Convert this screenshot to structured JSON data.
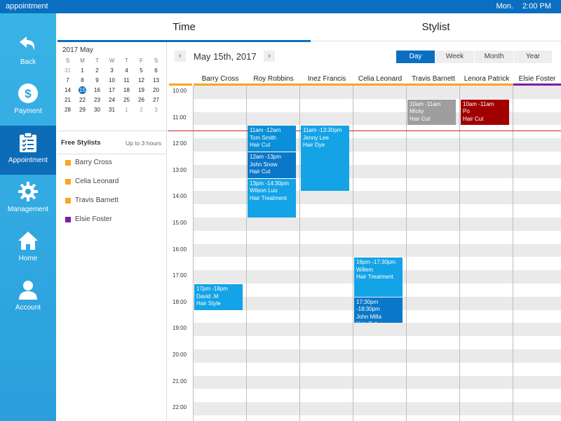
{
  "topbar": {
    "title": "appointment",
    "day": "Mon.",
    "time": "2:00 PM"
  },
  "sidebar": {
    "items": [
      {
        "label": "Back",
        "icon": "back-arrow-icon"
      },
      {
        "label": "Payment",
        "icon": "dollar-icon"
      },
      {
        "label": "Appointment",
        "icon": "clipboard-checklist-icon"
      },
      {
        "label": "Management",
        "icon": "gear-icon"
      },
      {
        "label": "Home",
        "icon": "home-icon"
      },
      {
        "label": "Account",
        "icon": "person-icon"
      }
    ],
    "active_index": 2
  },
  "tabs": [
    {
      "label": "Time"
    },
    {
      "label": "Stylist"
    }
  ],
  "mini_calendar": {
    "title": "2017 May",
    "weekdays": [
      "S",
      "M",
      "T",
      "W",
      "T",
      "F",
      "S"
    ],
    "weeks": [
      [
        "31",
        "1",
        "2",
        "3",
        "4",
        "5",
        "6"
      ],
      [
        "7",
        "8",
        "9",
        "10",
        "11",
        "12",
        "13"
      ],
      [
        "14",
        "15",
        "16",
        "17",
        "18",
        "19",
        "20"
      ],
      [
        "21",
        "22",
        "23",
        "24",
        "25",
        "26",
        "27"
      ],
      [
        "28",
        "29",
        "30",
        "31",
        "1",
        "2",
        "3"
      ]
    ],
    "selected": "15"
  },
  "free_stylists": {
    "title": "Free Stylists",
    "note": "Up to 3 hours",
    "items": [
      {
        "name": "Barry Cross",
        "color": "#f5a623"
      },
      {
        "name": "Celia Leonard",
        "color": "#f5a623"
      },
      {
        "name": "Travis Barnett",
        "color": "#f5a623"
      },
      {
        "name": "Elsie Foster",
        "color": "#7a1fa2"
      }
    ]
  },
  "calendar": {
    "prev": "‹",
    "next": "›",
    "date_title": "May 15th, 2017",
    "views": [
      "Day",
      "Week",
      "Month",
      "Year"
    ],
    "active_view": "Day",
    "stylists": [
      {
        "name": "Barry Cross",
        "color": "#f5a623"
      },
      {
        "name": "Roy Robbins",
        "color": "#f5a623"
      },
      {
        "name": "Inez Francis",
        "color": "#f5a623"
      },
      {
        "name": "Celia Leonard",
        "color": "#f5a623"
      },
      {
        "name": "Travis Barnett",
        "color": "#f5a623"
      },
      {
        "name": "Lenora Patrick",
        "color": "#f5a623"
      },
      {
        "name": "Elsie Foster",
        "color": "#7a1fa2"
      }
    ],
    "times": [
      "10:00",
      "11:00",
      "12:00",
      "13:00",
      "14:00",
      "15:00",
      "16:00",
      "17:00",
      "18:00",
      "19:00",
      "20:00",
      "21:00",
      "22:00"
    ],
    "appointments": [
      {
        "stylist": 4,
        "start": 10.0,
        "end": 11.0,
        "time": "10am -11am",
        "client": "Micky",
        "service": "Hair Cut",
        "color": "#9e9e9e"
      },
      {
        "stylist": 5,
        "start": 10.0,
        "end": 11.0,
        "time": "10am -11am",
        "client": "Po",
        "service": "Hair Cut",
        "color": "#a00000"
      },
      {
        "stylist": 1,
        "start": 11.0,
        "end": 12.0,
        "time": "11am -12am",
        "client": "Tom Smith",
        "service": "Hair Cut",
        "color": "#0a8fd8"
      },
      {
        "stylist": 2,
        "start": 11.0,
        "end": 13.5,
        "time": "11am -13:30pm",
        "client": "Jenny Lee",
        "service": "Hair Dye",
        "color": "#14a3e6"
      },
      {
        "stylist": 1,
        "start": 12.0,
        "end": 13.0,
        "time": "12am -13pm",
        "client": "John Snow",
        "service": "Hair Cut",
        "color": "#0a78c8"
      },
      {
        "stylist": 1,
        "start": 13.0,
        "end": 14.5,
        "time": "13pm -14:30pm",
        "client": "Wilson Luo",
        "service": "Hair Treatment",
        "color": "#14a3e6"
      },
      {
        "stylist": 3,
        "start": 16.0,
        "end": 17.5,
        "time": "16pm -17:30pm",
        "client": "Willem",
        "service": "Hair Treatment",
        "color": "#14a3e6"
      },
      {
        "stylist": 3,
        "start": 17.5,
        "end": 18.5,
        "time": "17:30pm -18:30pm",
        "client": "John Milla",
        "service": "Hair Cut",
        "color": "#0a78c8"
      },
      {
        "stylist": 0,
        "start": 17.0,
        "end": 18.0,
        "time": "17pm -18pm",
        "client": "David .M",
        "service": "Hair Style",
        "color": "#14a3e6"
      }
    ]
  }
}
